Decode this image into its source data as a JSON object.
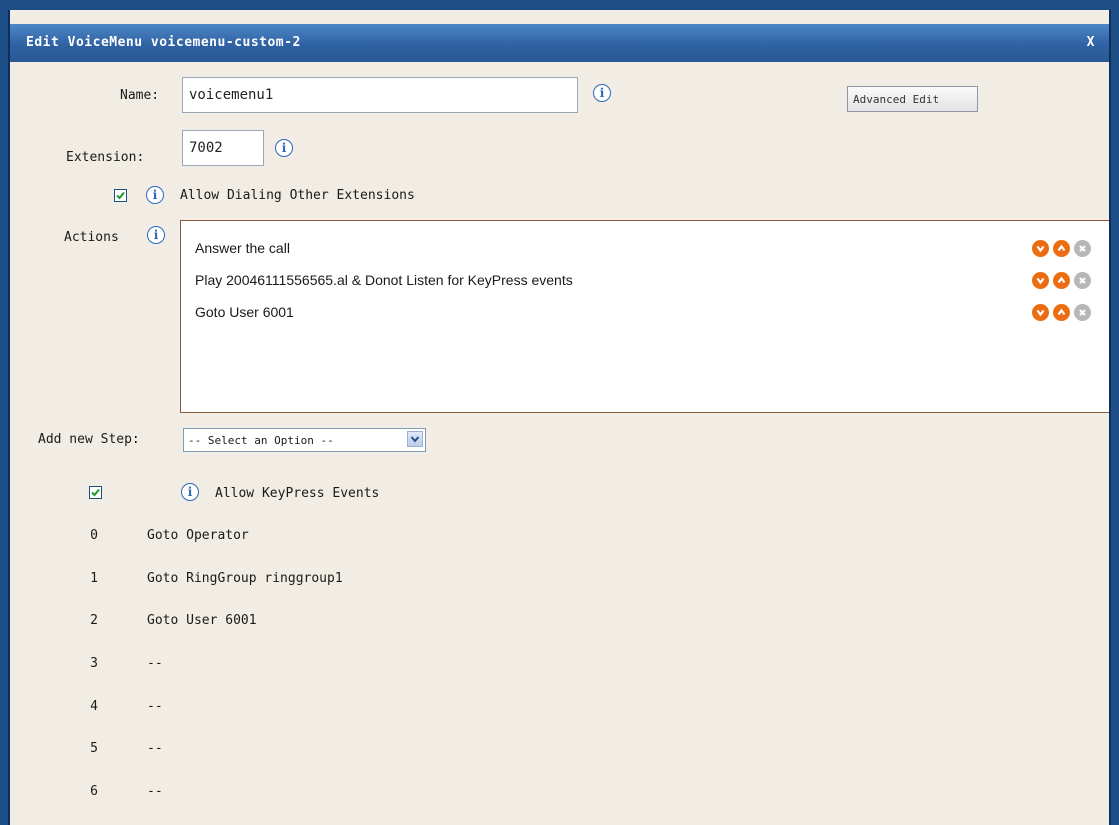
{
  "dialog": {
    "title": "Edit VoiceMenu voicemenu-custom-2",
    "close_label": "X"
  },
  "form": {
    "name_label": "Name:",
    "name_value": "voicemenu1",
    "advanced_edit_label": "Advanced Edit",
    "extension_label": "Extension:",
    "extension_value": "7002",
    "allow_dialing_label": "Allow Dialing Other Extensions",
    "allow_dialing_checked": true,
    "actions_label": "Actions",
    "add_step_label": "Add new Step:",
    "add_step_selected": "-- Select an Option --",
    "allow_keypress_label": "Allow KeyPress Events",
    "allow_keypress_checked": true
  },
  "actions": [
    {
      "text": "Answer the call"
    },
    {
      "text": "Play 20046111556565.al & Donot Listen for KeyPress events"
    },
    {
      "text": "Goto User 6001"
    }
  ],
  "icons": {
    "info": "info-icon",
    "move_down": "arrow-down-icon",
    "move_up": "arrow-up-icon",
    "delete": "close-circle-icon",
    "check": "check-icon",
    "dropdown": "chevron-down-icon"
  },
  "colors": {
    "title_bar": "#2f62a3",
    "panel_bg": "#f1ede4",
    "action_button": "#ea6d12",
    "delete_button": "#b7b7b7",
    "info_icon": "#2c68b8"
  },
  "keypress": [
    {
      "key": "0",
      "action": "Goto Operator"
    },
    {
      "key": "1",
      "action": "Goto RingGroup ringgroup1"
    },
    {
      "key": "2",
      "action": "Goto User 6001"
    },
    {
      "key": "3",
      "action": "--"
    },
    {
      "key": "4",
      "action": "--"
    },
    {
      "key": "5",
      "action": "--"
    },
    {
      "key": "6",
      "action": "--"
    }
  ]
}
